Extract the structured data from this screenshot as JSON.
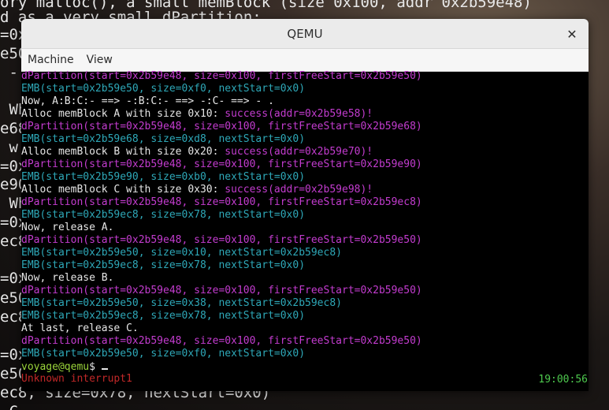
{
  "background_terminal": {
    "lines": [
      "ory malloc(), a small memBlock (size 0x100, addr 0x2b59e48)",
      "d as a very small dPartition:",
      "=0x",
      "e50",
      " - ",
      " Wh",
      "e68",
      " w ",
      "=0x",
      "e90",
      " Wh",
      "=0x",
      "ec8",
      "=0x",
      "e50",
      "ec8",
      "=0x",
      "e50",
      "ec8, size=0x78, nextStart=0x0)",
      " C"
    ]
  },
  "window": {
    "title": "QEMU",
    "close_label": "✕",
    "menu": [
      "Machine",
      "View"
    ]
  },
  "screen": {
    "lines": [
      {
        "parts": [
          {
            "t": "dPartition(start=0x2b59e48, size=0x100, firstFreeStart=0x2b59e50)",
            "c": "mag"
          }
        ]
      },
      {
        "parts": [
          {
            "t": "EMB(start=0x2b59e50, size=0xf0, nextStart=0x0)",
            "c": "cyan"
          }
        ]
      },
      {
        "parts": [
          {
            "t": "Now, A:B:C:- ==> -:B:C:- ==> -:C- ==> - .",
            "c": "white"
          }
        ]
      },
      {
        "parts": [
          {
            "t": "Alloc memBlock A with size 0x10: ",
            "c": "white"
          },
          {
            "t": "success(addr=0x2b59e58)!",
            "c": "mag"
          }
        ]
      },
      {
        "parts": [
          {
            "t": "dPartition(start=0x2b59e48, size=0x100, firstFreeStart=0x2b59e68)",
            "c": "mag"
          }
        ]
      },
      {
        "parts": [
          {
            "t": "EMB(start=0x2b59e68, size=0xd8, nextStart=0x0)",
            "c": "cyan"
          }
        ]
      },
      {
        "parts": [
          {
            "t": "Alloc memBlock B with size 0x20: ",
            "c": "white"
          },
          {
            "t": "success(addr=0x2b59e70)!",
            "c": "mag"
          }
        ]
      },
      {
        "parts": [
          {
            "t": "dPartition(start=0x2b59e48, size=0x100, firstFreeStart=0x2b59e90)",
            "c": "mag"
          }
        ]
      },
      {
        "parts": [
          {
            "t": "EMB(start=0x2b59e90, size=0xb0, nextStart=0x0)",
            "c": "cyan"
          }
        ]
      },
      {
        "parts": [
          {
            "t": "Alloc memBlock C with size 0x30: ",
            "c": "white"
          },
          {
            "t": "success(addr=0x2b59e98)!",
            "c": "mag"
          }
        ]
      },
      {
        "parts": [
          {
            "t": "dPartition(start=0x2b59e48, size=0x100, firstFreeStart=0x2b59ec8)",
            "c": "mag"
          }
        ]
      },
      {
        "parts": [
          {
            "t": "EMB(start=0x2b59ec8, size=0x78, nextStart=0x0)",
            "c": "cyan"
          }
        ]
      },
      {
        "parts": [
          {
            "t": "Now, release A.",
            "c": "white"
          }
        ]
      },
      {
        "parts": [
          {
            "t": "dPartition(start=0x2b59e48, size=0x100, firstFreeStart=0x2b59e50)",
            "c": "mag"
          }
        ]
      },
      {
        "parts": [
          {
            "t": "EMB(start=0x2b59e50, size=0x10, nextStart=0x2b59ec8)",
            "c": "cyan"
          }
        ]
      },
      {
        "parts": [
          {
            "t": "EMB(start=0x2b59ec8, size=0x78, nextStart=0x0)",
            "c": "cyan"
          }
        ]
      },
      {
        "parts": [
          {
            "t": "Now, release B.",
            "c": "white"
          }
        ]
      },
      {
        "parts": [
          {
            "t": "dPartition(start=0x2b59e48, size=0x100, firstFreeStart=0x2b59e50)",
            "c": "mag"
          }
        ]
      },
      {
        "parts": [
          {
            "t": "EMB(start=0x2b59e50, size=0x38, nextStart=0x2b59ec8)",
            "c": "cyan"
          }
        ]
      },
      {
        "parts": [
          {
            "t": "EMB(start=0x2b59ec8, size=0x78, nextStart=0x0)",
            "c": "cyan"
          }
        ]
      },
      {
        "parts": [
          {
            "t": "At last, release C.",
            "c": "white"
          }
        ]
      },
      {
        "parts": [
          {
            "t": "dPartition(start=0x2b59e48, size=0x100, firstFreeStart=0x2b59e50)",
            "c": "mag"
          }
        ]
      },
      {
        "parts": [
          {
            "t": "EMB(start=0x2b59e50, size=0xf0, nextStart=0x0)",
            "c": "cyan"
          }
        ]
      },
      {
        "parts": [
          {
            "t": "voyage@qemu",
            "c": "green"
          },
          {
            "t": "$ ",
            "c": "white"
          }
        ],
        "cursor": true
      },
      {
        "parts": [
          {
            "t": "Unknown interrupt1",
            "c": "red"
          }
        ]
      }
    ],
    "clock": "19:00:56"
  },
  "colors": {
    "magenta": "#c33ccf",
    "cyan": "#2ea8b8",
    "green": "#9bd53b",
    "red": "#c12828",
    "clock": "#4ec94e"
  }
}
